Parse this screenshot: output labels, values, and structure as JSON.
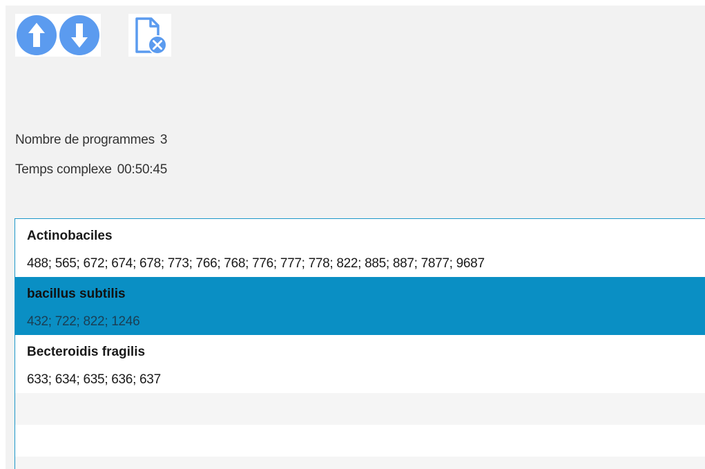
{
  "toolbar": {
    "buttons": [
      {
        "icon": "arrow-up-circle-icon",
        "color": "#5b9bef"
      },
      {
        "icon": "arrow-down-circle-icon",
        "color": "#5b9bef"
      },
      {
        "icon": "document-delete-icon",
        "color": "#5b9bef"
      }
    ]
  },
  "info": {
    "count_label": "Nombre de programmes",
    "count_value": "3",
    "time_label": "Temps complexe",
    "time_value": "00:50:45"
  },
  "list": {
    "accent": "#0a8fc4",
    "items": [
      {
        "name": "Actinobaciles",
        "codes": "488; 565; 672; 674; 678; 773; 766; 768; 776; 777; 778; 822; 885; 887; 7877; 9687",
        "selected": false
      },
      {
        "name": "bacillus subtilis",
        "codes": "432; 722; 822; 1246",
        "selected": true
      },
      {
        "name": "Becteroidis fragilis",
        "codes": "633; 634; 635; 636; 637",
        "selected": false
      }
    ]
  }
}
